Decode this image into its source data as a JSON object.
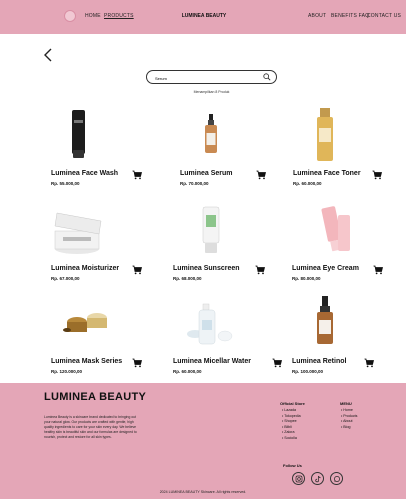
{
  "header": {
    "nav_left": [
      "HOME",
      "PRODUCTS"
    ],
    "brand": "LUMINEA BEAUTY",
    "nav_right": [
      "ABOUT",
      "BENEFITS FAQ",
      "CONTACT US"
    ]
  },
  "search": {
    "value": "Serum",
    "result_info": "Menampilkan 8 Produk"
  },
  "products": [
    {
      "name": "Luminea Face Wash",
      "price": "Rp. 55.000,00"
    },
    {
      "name": "Luminea Serum",
      "price": "Rp. 70.000,00"
    },
    {
      "name": "Luminea Face Toner",
      "price": "Rp. 60.000,00"
    },
    {
      "name": "Luminea Moisturizer",
      "price": "Rp. 67.000,00"
    },
    {
      "name": "Luminea Sunscreen",
      "price": "Rp. 68.000,00"
    },
    {
      "name": "Luminea Eye Cream",
      "price": "Rp. 80.000,00"
    },
    {
      "name": "Luminea Mask Series",
      "price": "Rp. 120.000,00"
    },
    {
      "name": "Luminea Micellar Water",
      "price": "Rp. 60.000,00"
    },
    {
      "name": "Luminea Retinol",
      "price": "Rp. 100.000,00"
    }
  ],
  "footer": {
    "brand": "LUMINEA BEAUTY",
    "description": "Luminea Beauty is a skincare brand dedicated to bringing out your natural glow. Our products are crafted with gentle, high quality ingredients to care for your skin every day. We believe healthy skin is beautiful skin and our formulas are designed to nourish, protect and restore for all skin types.",
    "official_store_title": "Official Store",
    "official_store": [
      "Lazada",
      "Tokopedia",
      "Shopee",
      "Blibli",
      "Zalora",
      "Sociolla"
    ],
    "menu_title": "MENU",
    "menu": [
      "Home",
      "Products",
      "About",
      "Blog"
    ],
    "follow_title": "Follow Us",
    "copyright": "2024 LUMINEA BEAUTY Skincare. All rights reserved."
  }
}
